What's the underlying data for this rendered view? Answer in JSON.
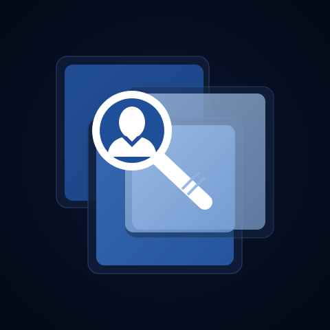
{
  "icon": {
    "name": "user-search-icon",
    "colors": {
      "background": "#050d1f",
      "card_dark": "#1f4b90",
      "card_mid": "#2f61a8",
      "glass": "#8fb5e4",
      "white": "#ffffff"
    }
  }
}
